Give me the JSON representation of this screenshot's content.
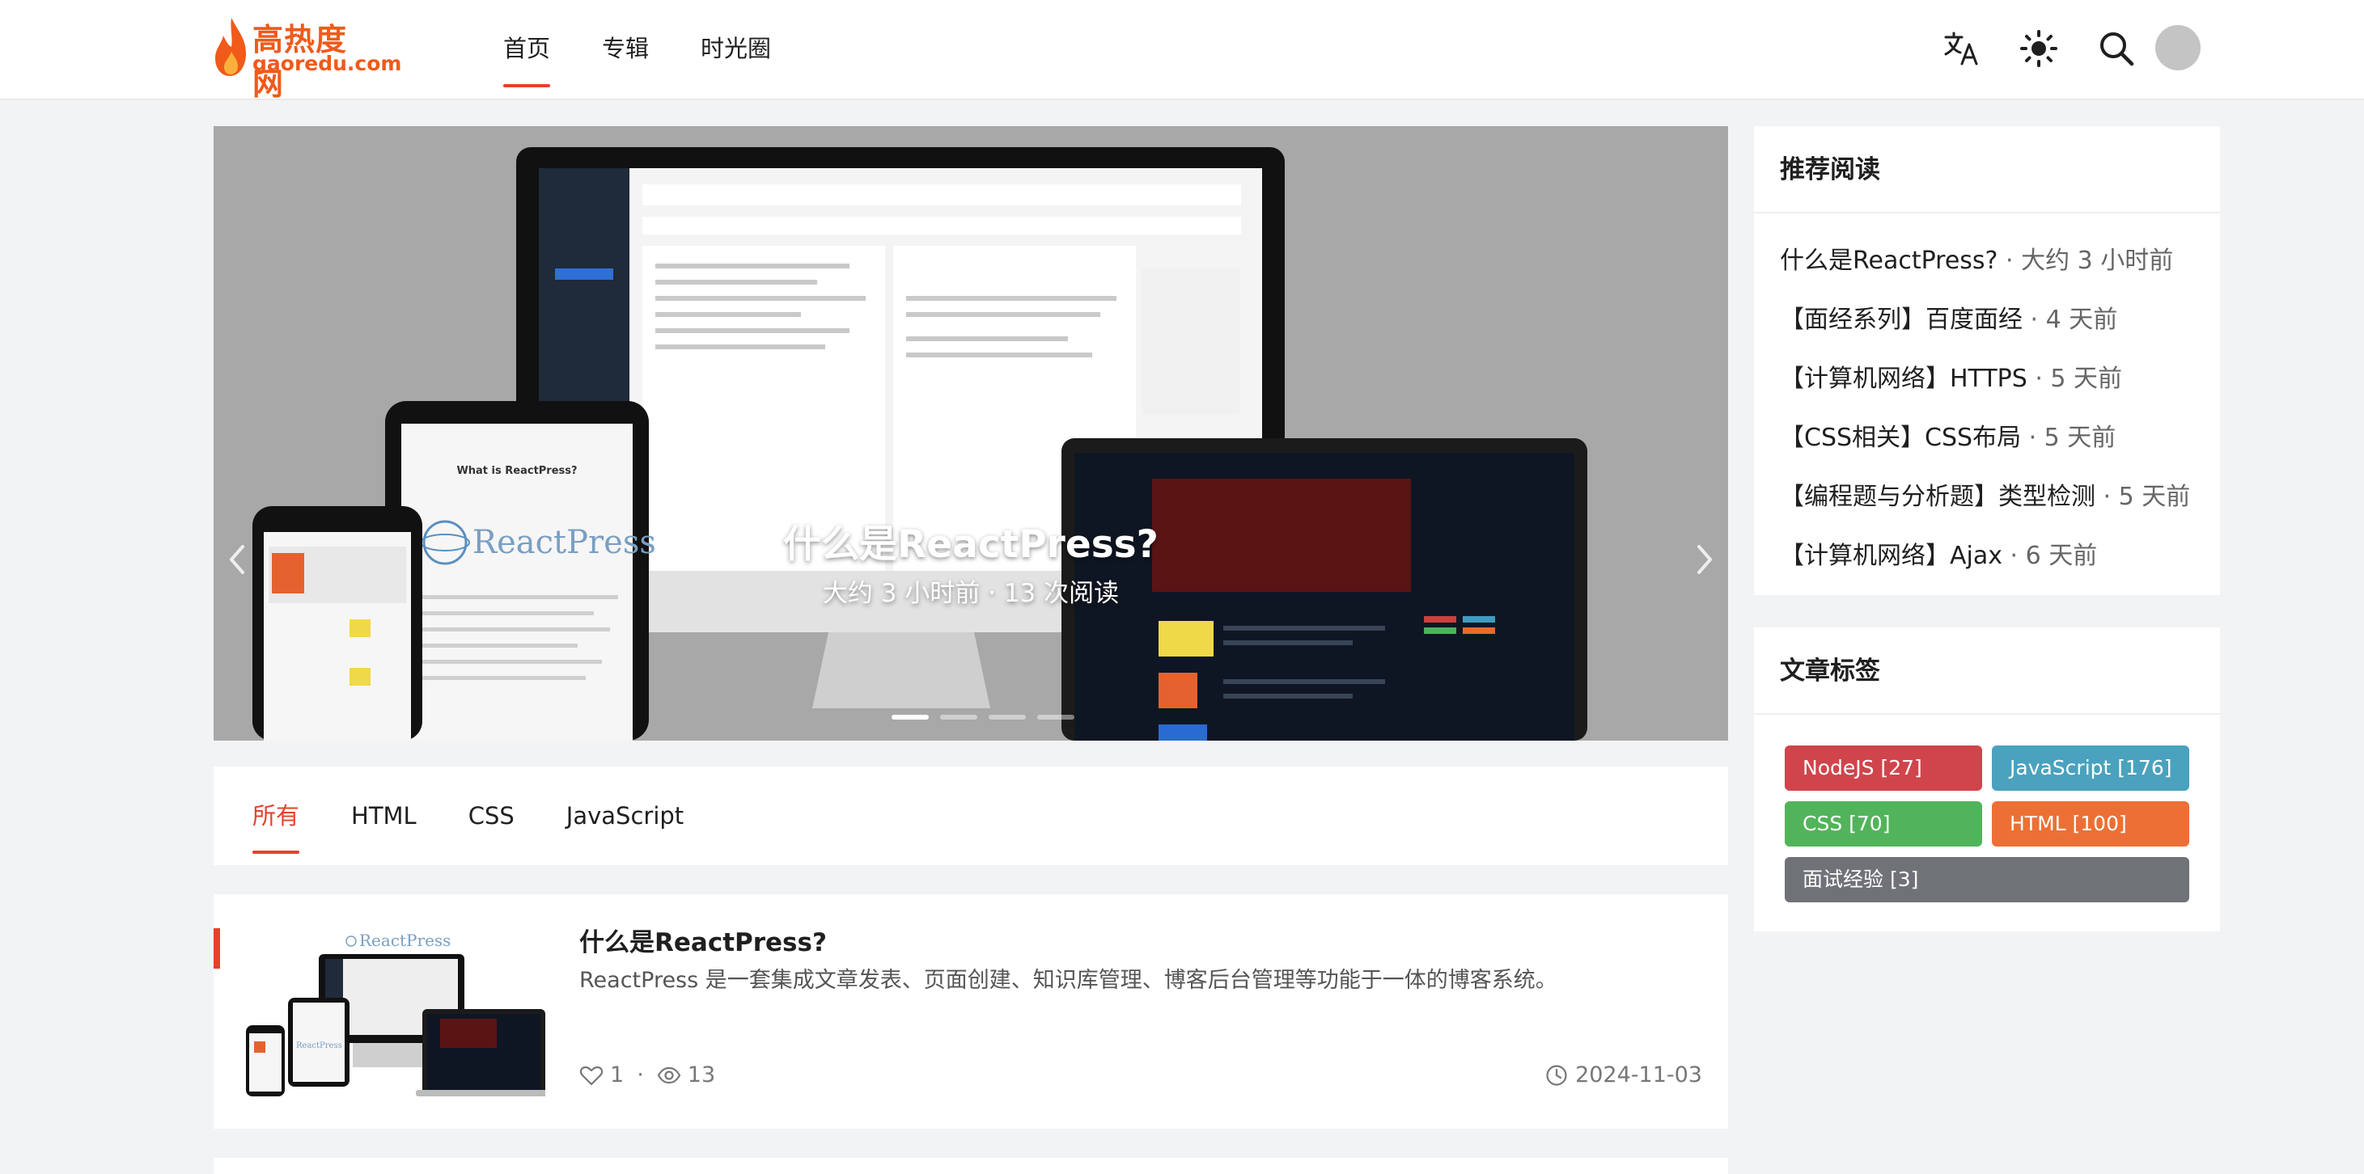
{
  "header": {
    "logo_text": "高热度网",
    "logo_sub": "gaoredu.com",
    "nav": [
      {
        "label": "首页",
        "active": true
      },
      {
        "label": "专辑",
        "active": false
      },
      {
        "label": "时光圈",
        "active": false
      }
    ],
    "icons": [
      "translate-icon",
      "sun-icon",
      "search-icon",
      "avatar"
    ]
  },
  "carousel": {
    "title": "什么是ReactPress?",
    "meta": "大约 3 小时前 · 13 次阅读",
    "slide_count": 4,
    "active_slide": 1
  },
  "tabs": [
    {
      "label": "所有",
      "active": true
    },
    {
      "label": "HTML",
      "active": false
    },
    {
      "label": "CSS",
      "active": false
    },
    {
      "label": "JavaScript",
      "active": false
    }
  ],
  "article": {
    "title": "什么是ReactPress?",
    "summary": "ReactPress 是一套集成文章发表、页面创建、知识库管理、博客后台管理等功能于一体的博客系统。",
    "likes": "1",
    "separator": "·",
    "views": "13",
    "date": "2024-11-03"
  },
  "recommend": {
    "heading": "推荐阅读",
    "items": [
      {
        "title": "什么是ReactPress?",
        "meta": " · 大约 3 小时前"
      },
      {
        "title": "【面经系列】百度面经",
        "meta": " · 4 天前"
      },
      {
        "title": "【计算机网络】HTTPS",
        "meta": " · 5 天前"
      },
      {
        "title": "【CSS相关】CSS布局",
        "meta": " · 5 天前"
      },
      {
        "title": "【编程题与分析题】类型检测",
        "meta": " · 5 天前"
      },
      {
        "title": "【计算机网络】Ajax",
        "meta": " · 6 天前"
      }
    ]
  },
  "tags": {
    "heading": "文章标签",
    "items": [
      {
        "label": "NodeJS [27]",
        "color": "#d0454c"
      },
      {
        "label": "JavaScript [176]",
        "color": "#4aa2be"
      },
      {
        "label": "CSS [70]",
        "color": "#52b45a"
      },
      {
        "label": "HTML [100]",
        "color": "#ec7035"
      },
      {
        "label": "面试经验 [3]",
        "color": "#6f7378"
      }
    ]
  },
  "colors": {
    "accent": "#e5412f",
    "background": "#f2f3f5"
  }
}
